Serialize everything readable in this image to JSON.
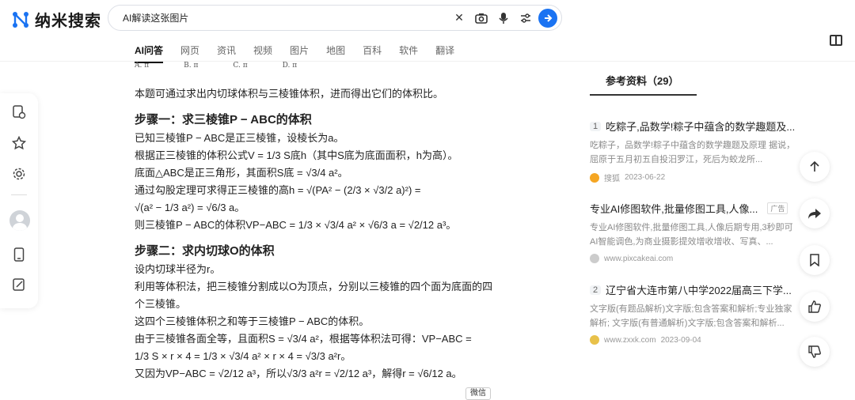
{
  "app": {
    "name": "纳米搜索"
  },
  "search": {
    "query": "AI解读这张图片"
  },
  "tabs": [
    "AI问答",
    "网页",
    "资讯",
    "视频",
    "图片",
    "地图",
    "百科",
    "软件",
    "翻译"
  ],
  "answer": {
    "options": [
      "A.  π",
      "B.  π",
      "C.  π",
      "D.  π"
    ],
    "intro": "本题可通过求出内切球体积与三棱锥体积，进而得出它们的体积比。",
    "step1_title": "步骤一：求三棱锥P − ABC的体积",
    "step1_lines": [
      "已知三棱锥P − ABC是正三棱锥，设棱长为a。",
      "根据正三棱锥的体积公式V = 1/3 S底h（其中S底为底面面积，h为高）。",
      "底面△ABC是正三角形，其面积S底 = √3/4 a²。",
      "通过勾股定理可求得正三棱锥的高h = √(PA² − (2/3 × √3/2 a)²) =",
      "√(a² − 1/3 a²) = √6/3 a。",
      "则三棱锥P − ABC的体积VP−ABC = 1/3 × √3/4 a² × √6/3 a = √2/12 a³。"
    ],
    "step2_title": "步骤二：求内切球O的体积",
    "step2_lines": [
      "设内切球半径为r。",
      "利用等体积法，把三棱锥分割成以O为顶点，分别以三棱锥的四个面为底面的四",
      "个三棱锥。",
      "这四个三棱锥体积之和等于三棱锥P − ABC的体积。",
      "由于三棱锥各面全等，且面积S = √3/4 a²，根据等体积法可得：VP−ABC =",
      "1/3 S × r × 4 = 1/3 × √3/4 a² × r × 4 = √3/3 a²r。",
      "又因为VP−ABC = √2/12 a³，所以√3/3 a²r = √2/12 a³，解得r = √6/12 a。"
    ],
    "wechat_tag": "微信"
  },
  "refs": {
    "title": "参考资料（29）",
    "items": [
      {
        "num": "1",
        "title": "吃粽子,品数学!粽子中蕴含的数学趣题及...",
        "desc": "吃粽子，品数学!粽子中蕴含的数学趣题及原理 据说，屈原于五月初五自投汨罗江，死后为蛟龙所...",
        "source": "搜狐",
        "date": "2023-06-22",
        "ad": ""
      },
      {
        "num": "",
        "title": "专业AI修图软件,批量修图工具,人像...",
        "desc": "专业AI修图软件,批量修图工具,人像后期专用,3秒即可AI智能调色,为商业摄影提效增收增收、写真、...",
        "source": "www.pixcakeai.com",
        "date": "",
        "ad": "广告"
      },
      {
        "num": "2",
        "title": "辽宁省大连市第八中学2022届高三下学...",
        "desc": "文字版(有题品解析)文字版;包含答案和解析;专业独家解析; 文字版(有普通解析)文字版;包含答案和解析...",
        "source": "www.zxxk.com",
        "date": "2023-09-04",
        "ad": ""
      }
    ]
  },
  "colors": {
    "accent": "#1a73f2"
  }
}
